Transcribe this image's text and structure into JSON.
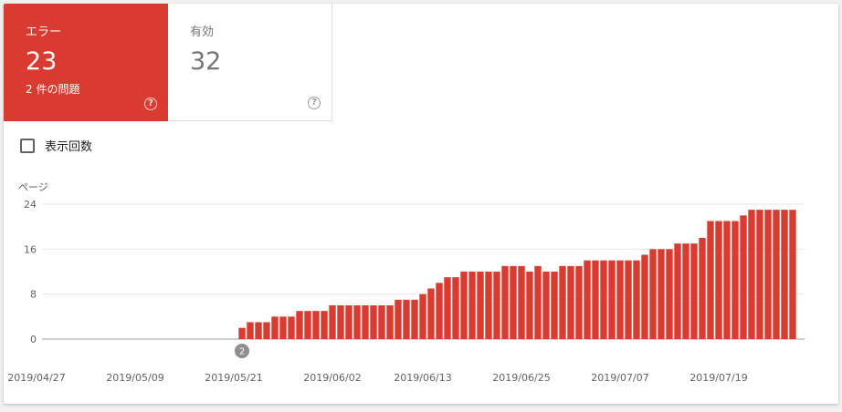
{
  "tiles": [
    {
      "label": "エラー",
      "count": "23",
      "sub": "2 件の問題"
    },
    {
      "label": "有効",
      "count": "32",
      "sub": ""
    }
  ],
  "impressions_checkbox": {
    "label": "表示回数",
    "checked": false
  },
  "colors": {
    "error": "#d93b30",
    "valid_text": "#757575",
    "marker": "#8e8e8e"
  },
  "chart_data": {
    "type": "bar",
    "ylabel": "ページ",
    "ylim": [
      0,
      24
    ],
    "yticks": [
      0,
      8,
      16,
      24
    ],
    "grid": true,
    "x_tick_labels": [
      "2019/04/27",
      "2019/05/09",
      "2019/05/21",
      "2019/06/02",
      "2019/06/13",
      "2019/06/25",
      "2019/07/07",
      "2019/07/19"
    ],
    "x_tick_indices": [
      0,
      12,
      24,
      36,
      47,
      59,
      71,
      83
    ],
    "values": [
      0,
      0,
      0,
      0,
      0,
      0,
      0,
      0,
      0,
      0,
      0,
      0,
      0,
      0,
      0,
      0,
      0,
      0,
      0,
      0,
      0,
      0,
      0,
      0,
      0,
      2,
      3,
      3,
      3,
      4,
      4,
      4,
      5,
      5,
      5,
      5,
      6,
      6,
      6,
      6,
      6,
      6,
      6,
      6,
      7,
      7,
      7,
      8,
      9,
      10,
      11,
      11,
      12,
      12,
      12,
      12,
      12,
      13,
      13,
      13,
      12,
      13,
      12,
      12,
      13,
      13,
      13,
      14,
      14,
      14,
      14,
      14,
      14,
      14,
      15,
      16,
      16,
      16,
      17,
      17,
      17,
      18,
      21,
      21,
      21,
      21,
      22,
      23,
      23,
      23,
      23,
      23,
      23
    ],
    "annotations": [
      {
        "index": 25,
        "label": "2"
      }
    ]
  }
}
